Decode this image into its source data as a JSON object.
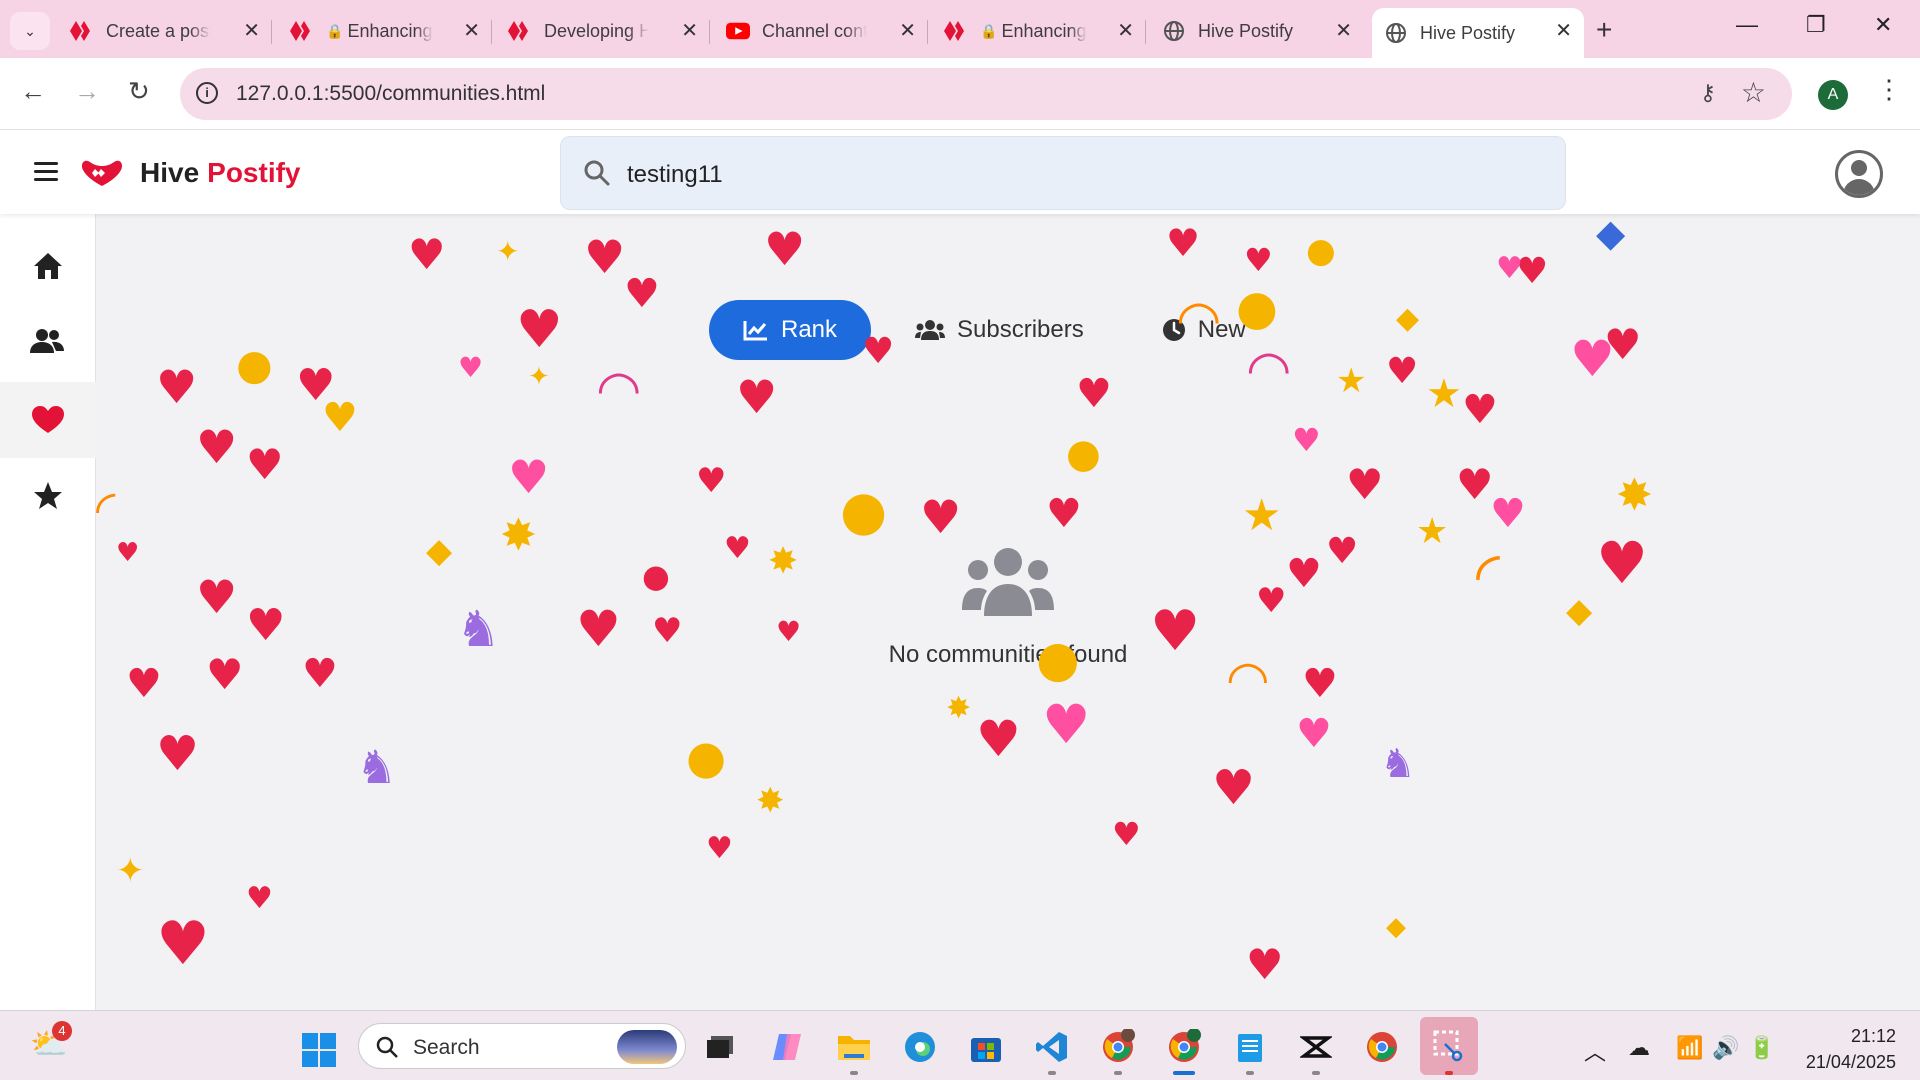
{
  "browser": {
    "tabs": [
      {
        "title": "Create a post",
        "icon": "hive-icon",
        "lock": false
      },
      {
        "title": "Enhancing",
        "icon": "hive-icon",
        "lock": true
      },
      {
        "title": "Developing Hi",
        "icon": "hive-icon",
        "lock": false
      },
      {
        "title": "Channel conte",
        "icon": "youtube-icon",
        "lock": false
      },
      {
        "title": "Enhancing",
        "icon": "hive-icon",
        "lock": true
      },
      {
        "title": "Hive Postify",
        "icon": "globe-icon",
        "lock": false
      },
      {
        "title": "Hive Postify",
        "icon": "globe-icon",
        "lock": false,
        "active": true
      }
    ],
    "url": "127.0.0.1:5500/communities.html",
    "profile_initial": "A"
  },
  "app": {
    "brand_first": "Hive",
    "brand_second": "Postify",
    "brand_color": "#e31337",
    "search_value": "testing11",
    "sort_tabs": [
      {
        "label": "Rank",
        "icon": "chart-line-icon",
        "active": true
      },
      {
        "label": "Subscribers",
        "icon": "users-icon",
        "active": false
      },
      {
        "label": "New",
        "icon": "clock-icon",
        "active": false
      }
    ],
    "accent_color": "#1d6bdc",
    "empty_message": "No communities found",
    "sidebar": [
      "home-icon",
      "communities-icon",
      "hive-heart-icon",
      "star-icon"
    ]
  },
  "taskbar": {
    "weather_badge": "4",
    "search_label": "Search",
    "time": "21:12",
    "date": "21/04/2025"
  }
}
